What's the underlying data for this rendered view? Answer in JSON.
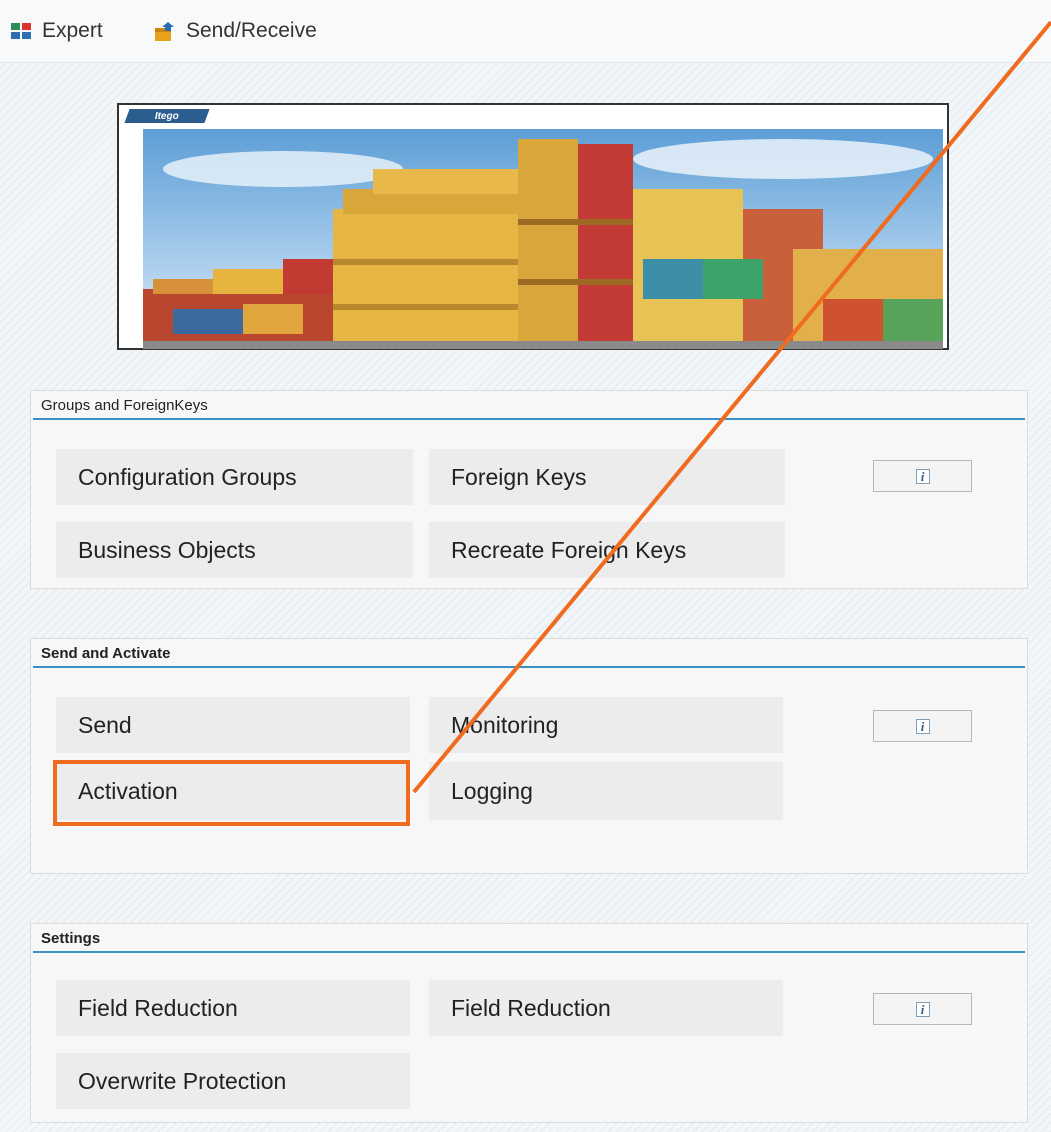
{
  "toolbar": {
    "expert_label": "Expert",
    "send_receive_label": "Send/Receive"
  },
  "banner": {
    "logo_text": "Itego"
  },
  "sections": {
    "groups": {
      "title": "Groups and ForeignKeys",
      "configuration_groups": "Configuration Groups",
      "foreign_keys": "Foreign Keys",
      "business_objects": "Business Objects",
      "recreate_foreign_keys": "Recreate Foreign Keys"
    },
    "send_activate": {
      "title": "Send and Activate",
      "send": "Send",
      "monitoring": "Monitoring",
      "activation": "Activation",
      "logging": "Logging"
    },
    "settings": {
      "title": "Settings",
      "field_reduction_1": "Field Reduction",
      "field_reduction_2": "Field Reduction",
      "overwrite_protection": "Overwrite Protection"
    }
  },
  "info_glyph": "i",
  "colors": {
    "accent_line": "#3b8fc7",
    "highlight": "#ee6b1f",
    "button_bg": "#ececec"
  }
}
